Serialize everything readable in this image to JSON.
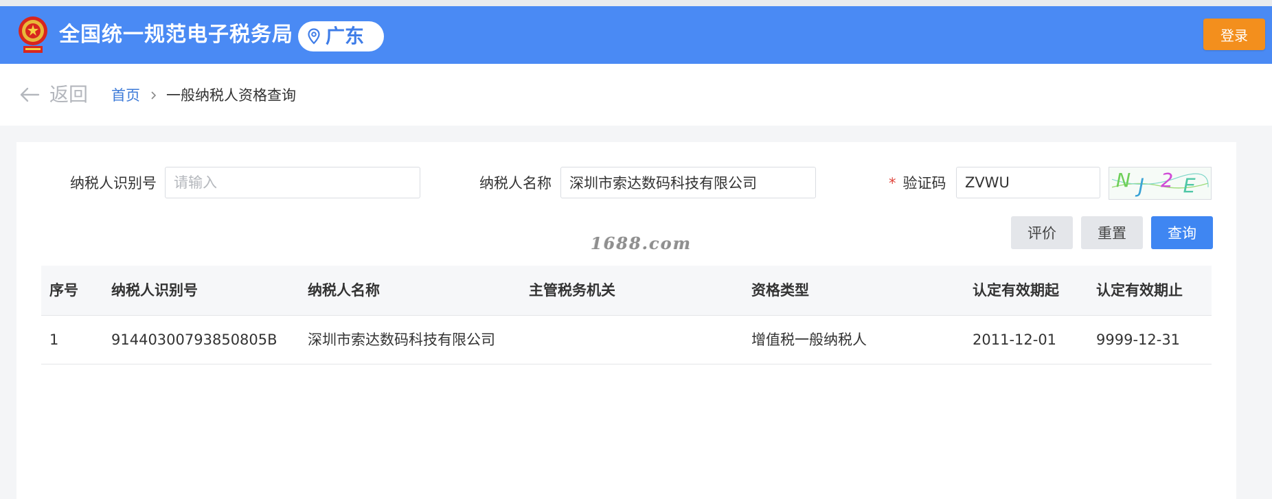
{
  "header": {
    "site_title": "全国统一规范电子税务局",
    "region": "广东",
    "login_label": "登录",
    "brand_color": "#4a8af4",
    "login_color": "#f38f1d"
  },
  "nav": {
    "back_label": "返回",
    "breadcrumb_home": "首页",
    "breadcrumb_current": "一般纳税人资格查询"
  },
  "form": {
    "taxpayer_id_label": "纳税人识别号",
    "taxpayer_id_value": "",
    "taxpayer_id_placeholder": "请输入",
    "taxpayer_name_label": "纳税人名称",
    "taxpayer_name_value": "深圳市索达数码科技有限公司",
    "captcha_required_mark": "*",
    "captcha_label": "验证码",
    "captcha_value": "ZVWU",
    "captcha_image_text": "NJ2E"
  },
  "buttons": {
    "evaluate": "评价",
    "reset": "重置",
    "query": "查询",
    "query_color": "#3f86f2"
  },
  "watermark": "1688.com",
  "table": {
    "columns": [
      "序号",
      "纳税人识别号",
      "纳税人名称",
      "主管税务机关",
      "资格类型",
      "认定有效期起",
      "认定有效期止"
    ],
    "rows": [
      [
        "1",
        "91440300793850805B",
        "深圳市索达数码科技有限公司",
        "",
        "增值税一般纳税人",
        "2011-12-01",
        "9999-12-31"
      ]
    ]
  }
}
